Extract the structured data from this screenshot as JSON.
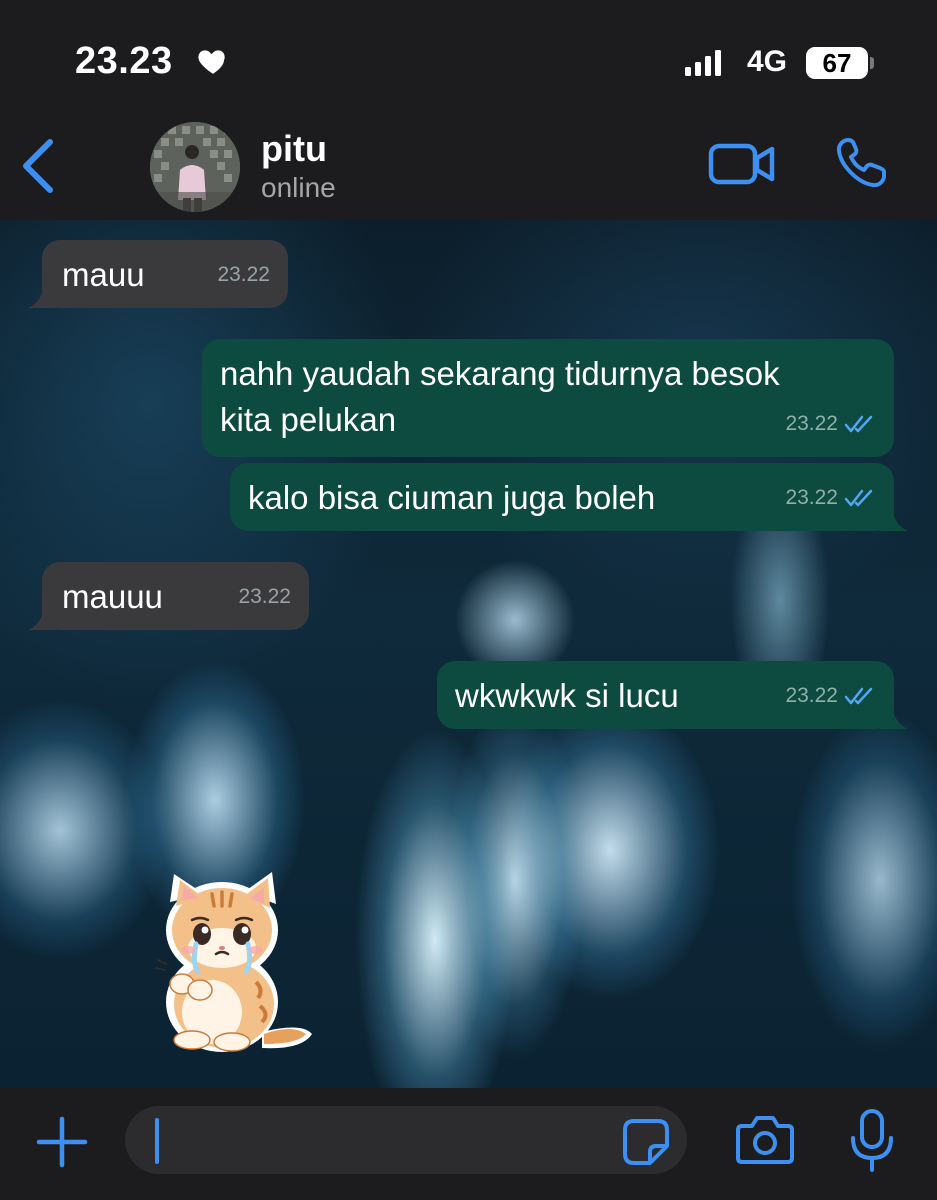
{
  "status_bar": {
    "time": "23.23",
    "network": "4G",
    "battery": "67"
  },
  "header": {
    "contact_name": "pitu",
    "contact_status": "online"
  },
  "messages": [
    {
      "direction": "incoming",
      "text": "mauu",
      "time": "23.22"
    },
    {
      "direction": "outgoing",
      "text_line1": "nahh yaudah sekarang tidurnya besok",
      "text_line2": "kita pelukan",
      "time": "23.22",
      "status": "read"
    },
    {
      "direction": "outgoing",
      "text": "kalo bisa ciuman juga boleh",
      "time": "23.22",
      "status": "read"
    },
    {
      "direction": "incoming",
      "text": "mauuu",
      "time": "23.22"
    },
    {
      "direction": "outgoing",
      "text": "wkwkwk si lucu",
      "time": "23.22",
      "status": "read"
    }
  ],
  "sticker": {
    "icon": "crying-cat-sticker"
  },
  "input": {
    "value": "",
    "placeholder": ""
  },
  "colors": {
    "accent": "#3e8ff2",
    "incoming_bubble": "#3a3a3c",
    "outgoing_bubble": "#0d4a3f",
    "read_ticks": "#53a6f5"
  }
}
